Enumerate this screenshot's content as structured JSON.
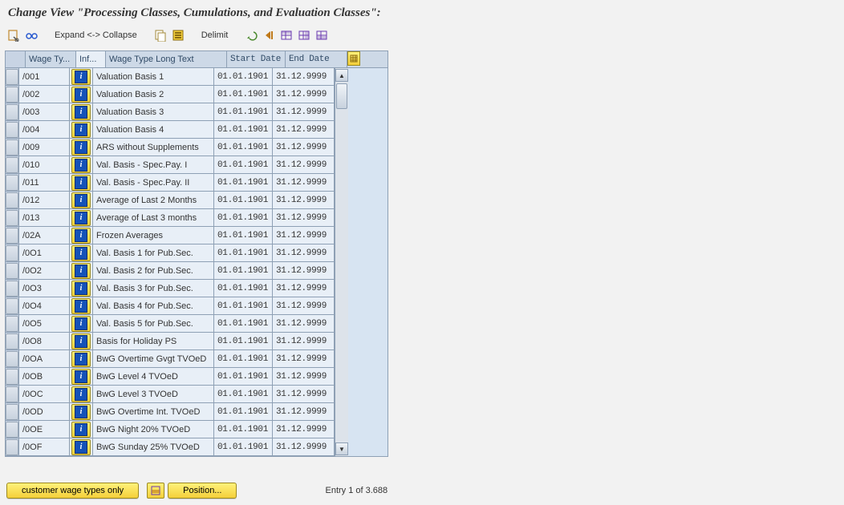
{
  "title_prefix": "Change View ",
  "title_quoted": "\"Processing Classes, Cumulations, and Evaluation Classes\":",
  "toolbar": {
    "expand_collapse": "Expand <-> Collapse",
    "delimit": "Delimit"
  },
  "columns": {
    "sel": "",
    "wage_type": "Wage Ty...",
    "info": "Inf...",
    "long_text": "Wage Type Long Text",
    "start_date": "Start Date",
    "end_date": "End Date"
  },
  "rows": [
    {
      "wt": "/001",
      "txt": "Valuation Basis 1",
      "sd": "01.01.1901",
      "ed": "31.12.9999"
    },
    {
      "wt": "/002",
      "txt": "Valuation Basis 2",
      "sd": "01.01.1901",
      "ed": "31.12.9999"
    },
    {
      "wt": "/003",
      "txt": "Valuation Basis 3",
      "sd": "01.01.1901",
      "ed": "31.12.9999"
    },
    {
      "wt": "/004",
      "txt": "Valuation Basis 4",
      "sd": "01.01.1901",
      "ed": "31.12.9999"
    },
    {
      "wt": "/009",
      "txt": "ARS without Supplements",
      "sd": "01.01.1901",
      "ed": "31.12.9999"
    },
    {
      "wt": "/010",
      "txt": "Val. Basis - Spec.Pay. I",
      "sd": "01.01.1901",
      "ed": "31.12.9999"
    },
    {
      "wt": "/011",
      "txt": "Val. Basis - Spec.Pay. II",
      "sd": "01.01.1901",
      "ed": "31.12.9999"
    },
    {
      "wt": "/012",
      "txt": "Average of Last 2 Months",
      "sd": "01.01.1901",
      "ed": "31.12.9999"
    },
    {
      "wt": "/013",
      "txt": "Average of Last 3 months",
      "sd": "01.01.1901",
      "ed": "31.12.9999"
    },
    {
      "wt": "/02A",
      "txt": "Frozen Averages",
      "sd": "01.01.1901",
      "ed": "31.12.9999"
    },
    {
      "wt": "/0O1",
      "txt": "Val. Basis 1 for Pub.Sec.",
      "sd": "01.01.1901",
      "ed": "31.12.9999"
    },
    {
      "wt": "/0O2",
      "txt": "Val. Basis 2 for Pub.Sec.",
      "sd": "01.01.1901",
      "ed": "31.12.9999"
    },
    {
      "wt": "/0O3",
      "txt": "Val. Basis 3 for Pub.Sec.",
      "sd": "01.01.1901",
      "ed": "31.12.9999"
    },
    {
      "wt": "/0O4",
      "txt": "Val. Basis 4 for Pub.Sec.",
      "sd": "01.01.1901",
      "ed": "31.12.9999"
    },
    {
      "wt": "/0O5",
      "txt": "Val. Basis 5 for Pub.Sec.",
      "sd": "01.01.1901",
      "ed": "31.12.9999"
    },
    {
      "wt": "/0O8",
      "txt": "Basis for Holiday PS",
      "sd": "01.01.1901",
      "ed": "31.12.9999"
    },
    {
      "wt": "/0OA",
      "txt": "BwG Overtime Gvgt TVOeD",
      "sd": "01.01.1901",
      "ed": "31.12.9999"
    },
    {
      "wt": "/0OB",
      "txt": "BwG Level 4 TVOeD",
      "sd": "01.01.1901",
      "ed": "31.12.9999"
    },
    {
      "wt": "/0OC",
      "txt": "BwG Level 3 TVOeD",
      "sd": "01.01.1901",
      "ed": "31.12.9999"
    },
    {
      "wt": "/0OD",
      "txt": "BwG Overtime Int. TVOeD",
      "sd": "01.01.1901",
      "ed": "31.12.9999"
    },
    {
      "wt": "/0OE",
      "txt": "BwG Night 20% TVOeD",
      "sd": "01.01.1901",
      "ed": "31.12.9999"
    },
    {
      "wt": "/0OF",
      "txt": "BwG Sunday 25% TVOeD",
      "sd": "01.01.1901",
      "ed": "31.12.9999"
    }
  ],
  "bottom": {
    "customer_btn": "customer wage types only",
    "position_btn": "Position...",
    "entry_text": "Entry 1 of 3.688"
  },
  "info_glyph": "i"
}
